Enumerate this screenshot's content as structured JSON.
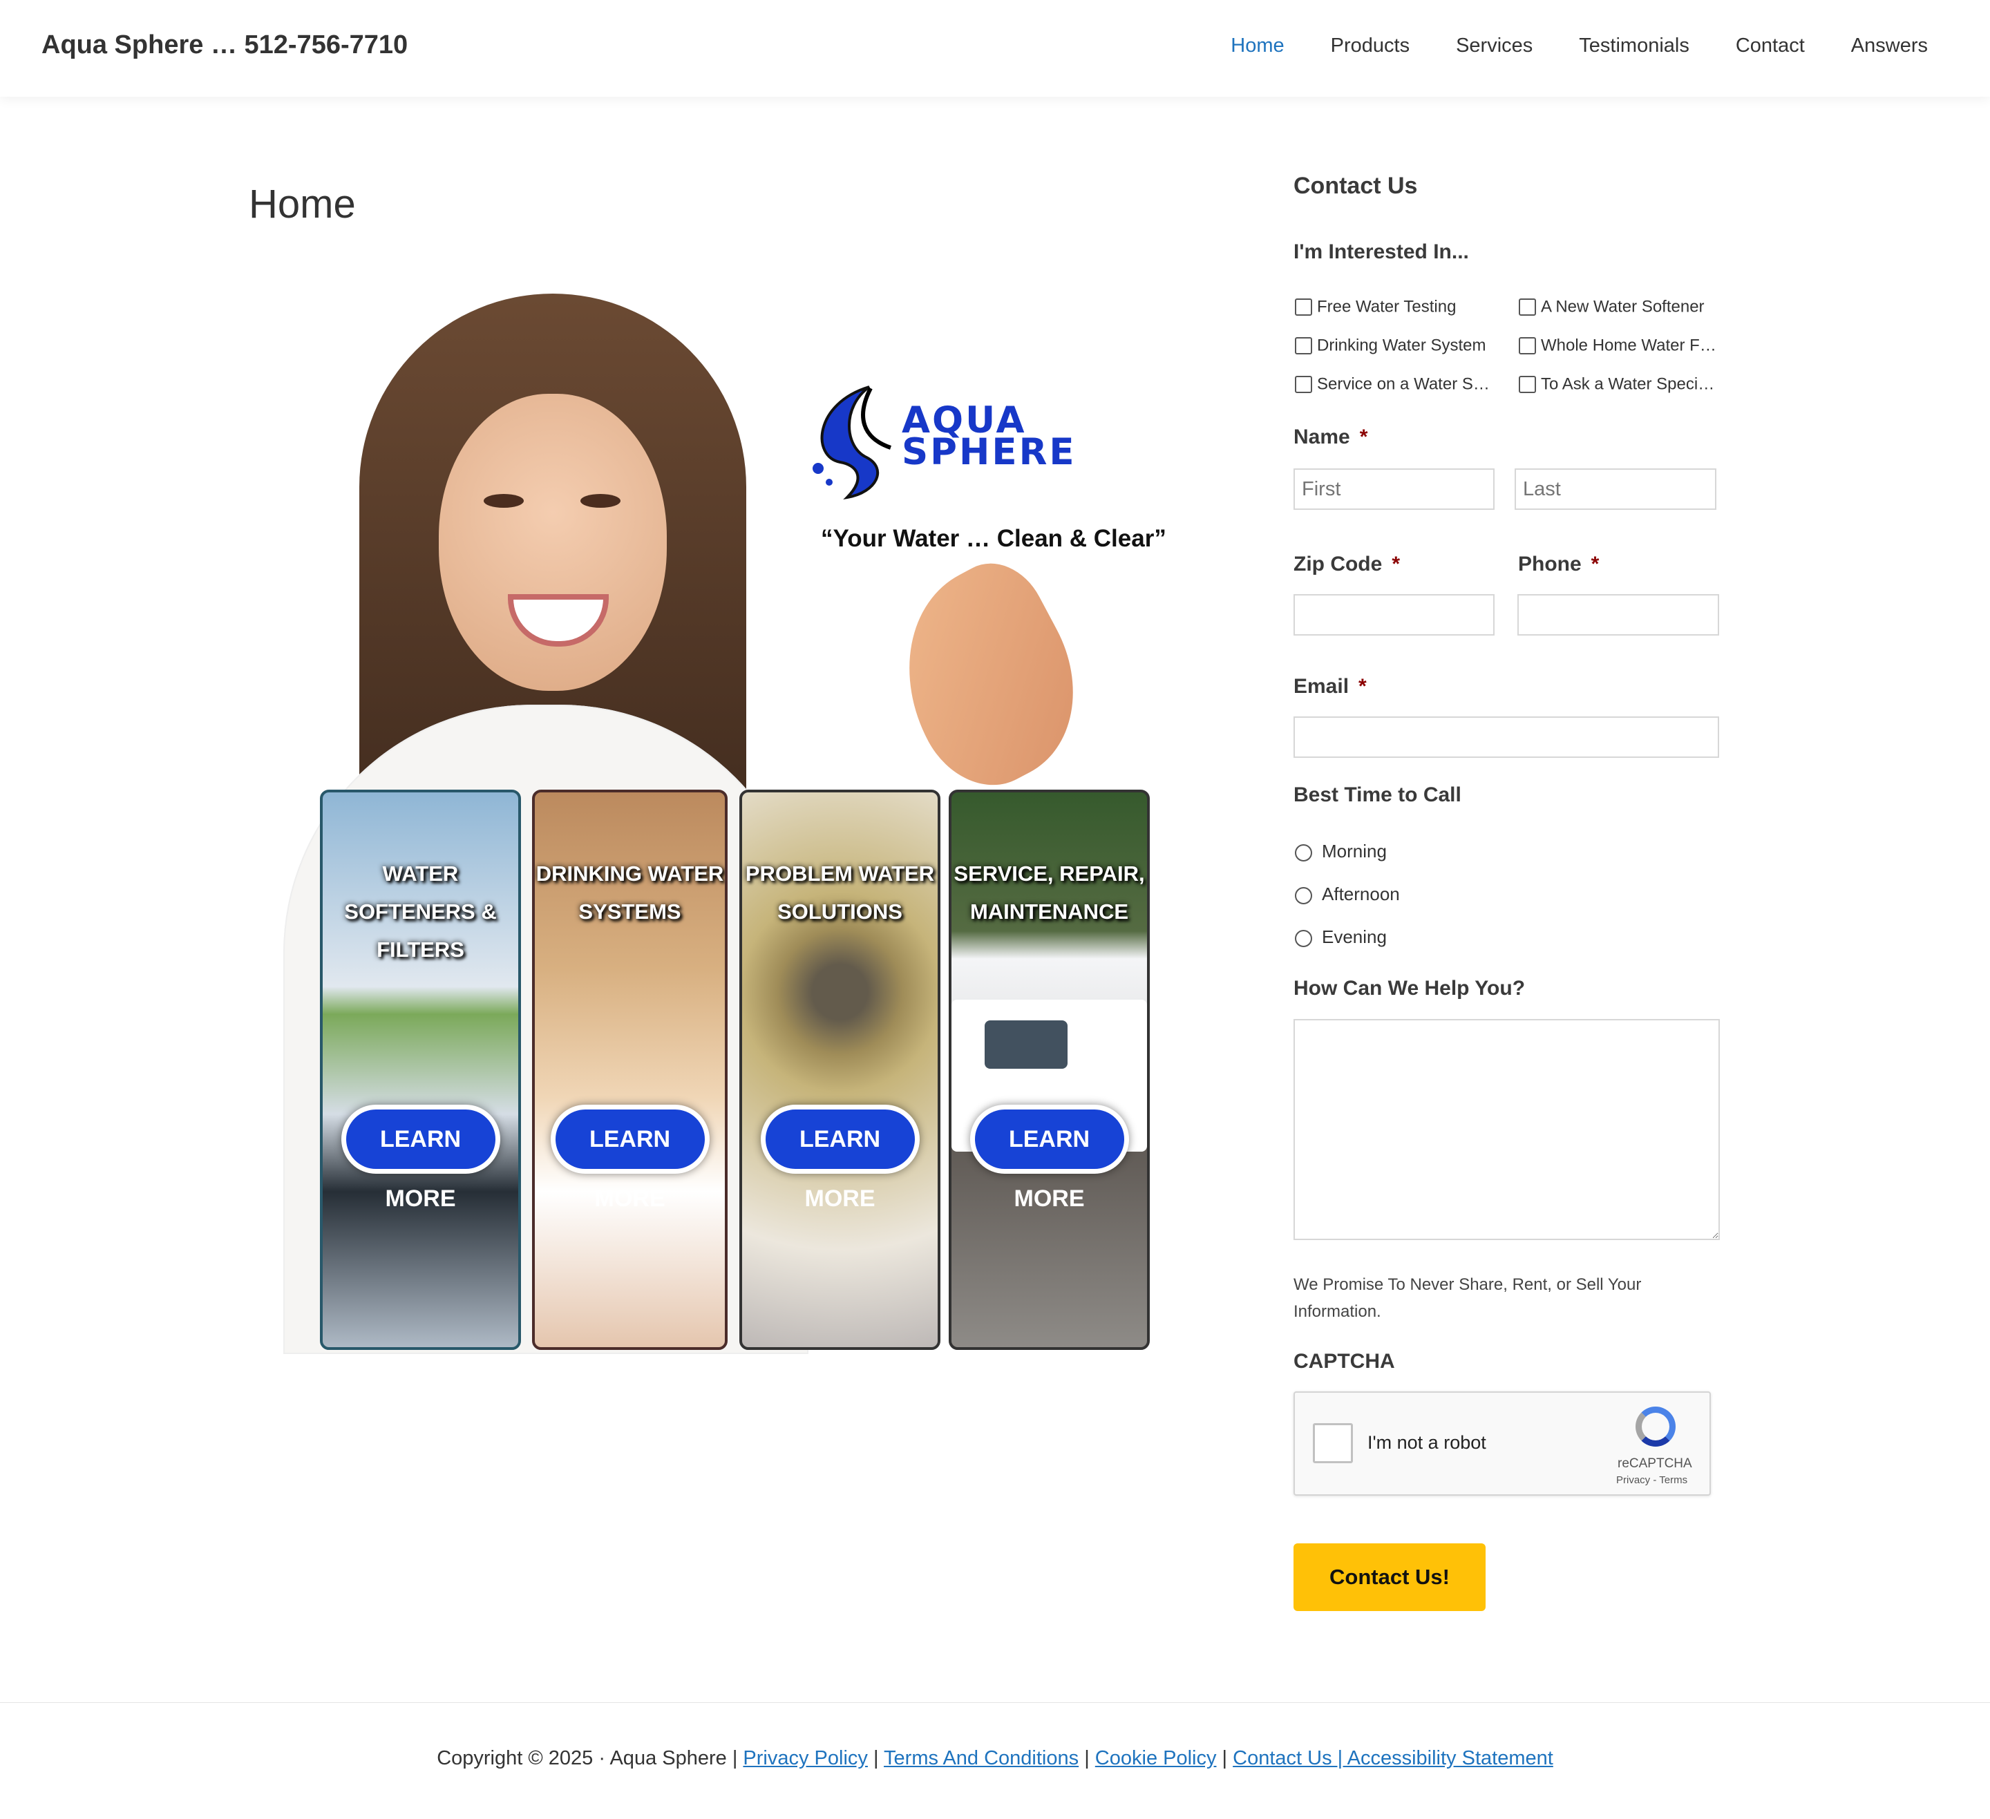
{
  "header": {
    "site_title": "Aqua Sphere … 512-756-7710",
    "nav": [
      "Home",
      "Products",
      "Services",
      "Testimonials",
      "Contact",
      "Answers"
    ]
  },
  "main": {
    "title": "Home",
    "hero": {
      "logo_text": "AQUA SPHERE",
      "tagline": "“Your Water … Clean & Clear”",
      "cards": [
        {
          "title": "WATER SOFTENERS & FILTERS",
          "button": "LEARN MORE"
        },
        {
          "title": "DRINKING WATER SYSTEMS",
          "button": "LEARN MORE"
        },
        {
          "title": "PROBLEM WATER SOLUTIONS",
          "button": "LEARN MORE"
        },
        {
          "title": "SERVICE, REPAIR, MAINTENANCE",
          "button": "LEARN MORE"
        }
      ]
    }
  },
  "contact": {
    "heading": "Contact Us",
    "interest_label": "I'm Interested In...",
    "interests": [
      "Free Water Testing",
      "A New Water Softener",
      "Drinking Water System",
      "Whole Home Water F…",
      "Service on a Water S…",
      "To Ask a Water Speci…"
    ],
    "name_label": "Name",
    "first_placeholder": "First",
    "last_placeholder": "Last",
    "zip_label": "Zip Code",
    "phone_label": "Phone",
    "email_label": "Email",
    "required_mark": "*",
    "best_time_label": "Best Time to Call",
    "best_time_options": [
      "Morning",
      "Afternoon",
      "Evening"
    ],
    "help_label": "How Can We Help You?",
    "promise": "We Promise To Never Share, Rent, or Sell Your Information.",
    "captcha_label": "CAPTCHA",
    "captcha_text": "I'm not a robot",
    "captcha_brand": "reCAPTCHA",
    "captcha_links": "Privacy - Terms",
    "submit": "Contact Us!"
  },
  "footer": {
    "prefix": "Copyright © 2025 · Aqua Sphere | ",
    "links": [
      "Privacy Policy",
      "Terms And Conditions",
      "Cookie Policy",
      "Contact Us | Accessibility Statement"
    ]
  }
}
